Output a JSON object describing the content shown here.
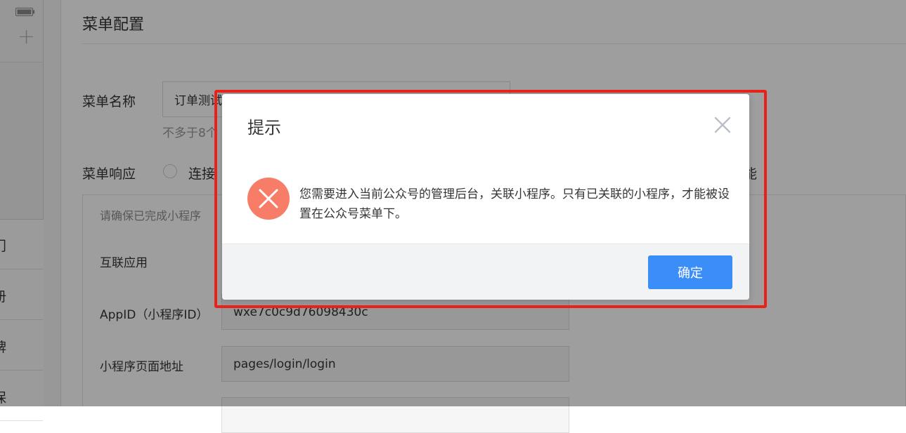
{
  "sidebar": {
    "menu_tabs": [
      "门",
      "册",
      "牌",
      "保"
    ]
  },
  "form": {
    "section_title": "菜单配置",
    "menu_name_label": "菜单名称",
    "menu_name_value": "订单测试",
    "menu_name_hint": "不多于8个",
    "menu_response_label": "菜单响应",
    "response_option_1": "连接",
    "response_option_tail": "能",
    "card_hint": "请确保已完成小程序",
    "interconnect_label": "互联应用",
    "appid_label": "AppID（小程序ID）",
    "appid_value": "wxe7c0c9d76098430c",
    "page_path_label": "小程序页面地址",
    "page_path_value": "pages/login/login"
  },
  "dialog": {
    "title": "提示",
    "message": "您需要进入当前公众号的管理后台，关联小程序。只有已关联的小程序，才能被设置在公众号菜单下。",
    "ok_label": "确定",
    "icon": "error-x-icon",
    "icon_color": "#f87d68",
    "highlight_color": "#e8211a",
    "button_color": "#3b8ef8"
  }
}
